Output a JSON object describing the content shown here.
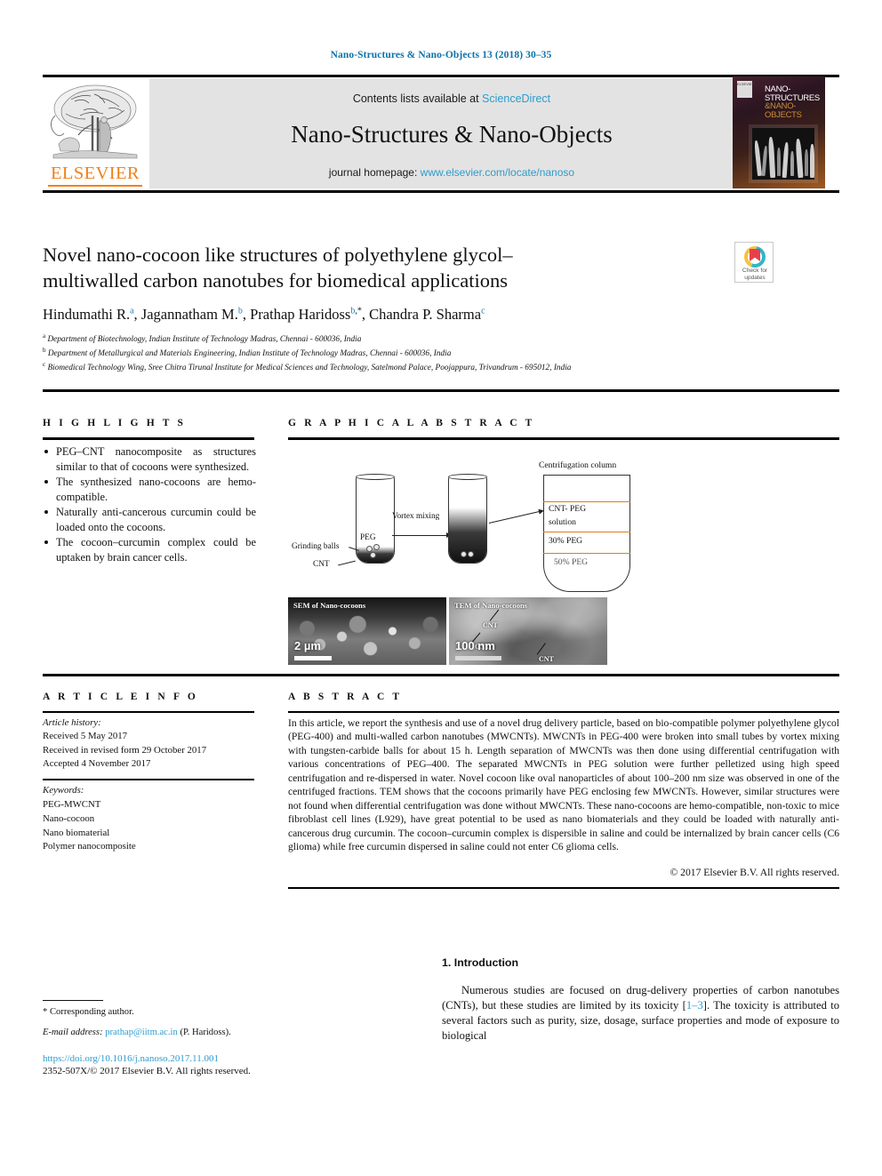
{
  "running_head": "Nano-Structures & Nano-Objects 13 (2018) 30–35",
  "masthead": {
    "contents_prefix": "Contents lists available at ",
    "contents_link": "ScienceDirect",
    "journal_name": "Nano-Structures & Nano-Objects",
    "homepage_prefix": "journal homepage: ",
    "homepage_link": "www.elsevier.com/locate/nanoso",
    "publisher_wordmark": "ELSEVIER"
  },
  "cover": {
    "line1": "NANO-",
    "line2": "STRUCTURES",
    "line3": "&NANO-",
    "line4": "OBJECTS",
    "badge": "ELSEVIER"
  },
  "crossmark": {
    "line1": "Check for",
    "line2": "updates"
  },
  "article": {
    "title": "Novel nano-cocoon like structures of polyethylene glycol–multiwalled carbon nanotubes for biomedical applications",
    "authors": [
      {
        "name": "Hindumathi R.",
        "sup": "a",
        "star": false
      },
      {
        "name": "Jagannatham M.",
        "sup": "b",
        "star": false
      },
      {
        "name": "Prathap Haridoss",
        "sup": "b",
        "star": true
      },
      {
        "name": "Chandra P. Sharma",
        "sup": "c",
        "star": false
      }
    ],
    "affiliations": [
      {
        "marker": "a",
        "text": "Department of Biotechnology, Indian Institute of Technology Madras, Chennai - 600036, India"
      },
      {
        "marker": "b",
        "text": "Department of Metallurgical and Materials Engineering, Indian Institute of Technology Madras, Chennai - 600036, India"
      },
      {
        "marker": "c",
        "text": "Biomedical Technology Wing, Sree Chitra Tirunal Institute for Medical Sciences and Technology, Satelmond Palace, Poojappura, Trivandrum - 695012, India"
      }
    ]
  },
  "highlights": {
    "heading": "H I G H L I G H T S",
    "items": [
      "PEG–CNT nanocomposite as structures similar to that of cocoons were synthesized.",
      "The synthesized nano-cocoons are hemo-compatible.",
      "Naturally anti-cancerous curcumin could be loaded onto the cocoons.",
      "The cocoon–curcumin complex could be uptaken by brain cancer cells."
    ]
  },
  "graphical_abstract": {
    "heading": "G R A P H I C A L   A B S T R A C T",
    "labels": {
      "grinding_balls": "Grinding balls",
      "cnt": "CNT",
      "peg": "PEG",
      "vortex_mixing": "Vortex mixing",
      "centrifugation_column": "Centrifugation column",
      "fraction_1_line1": "CNT- PEG",
      "fraction_1_line2": "solution",
      "fraction_2": "30% PEG",
      "fraction_3": "50% PEG"
    },
    "micrographs": [
      {
        "caption": "SEM of Nano-cocoons",
        "scale": "2 µm",
        "annotations": []
      },
      {
        "caption": "TEM of Nano-cocoons",
        "scale": "100 nm",
        "annotations": [
          "CNT",
          "CNT",
          "CNT"
        ]
      }
    ]
  },
  "article_info": {
    "heading": "A R T I C L E   I N F O",
    "history_label": "Article history:",
    "history": [
      "Received 5 May 2017",
      "Received in revised form 29 October 2017",
      "Accepted 4 November 2017"
    ],
    "keywords_label": "Keywords:",
    "keywords": [
      "PEG-MWCNT",
      "Nano-cocoon",
      "Nano biomaterial",
      "Polymer nanocomposite"
    ]
  },
  "abstract": {
    "heading": "A B S T R A C T",
    "text": "In this article, we report the synthesis and use of a novel drug delivery particle, based on bio-compatible polymer polyethylene glycol (PEG-400) and multi-walled carbon nanotubes (MWCNTs). MWCNTs in PEG-400 were broken into small tubes by vortex mixing with tungsten-carbide balls for about 15 h. Length separation of MWCNTs was then done using differential centrifugation with various concentrations of PEG–400. The separated MWCNTs in PEG solution were further pelletized using high speed centrifugation and re-dispersed in water. Novel cocoon like oval nanoparticles of about 100–200 nm size was observed in one of the centrifuged fractions. TEM shows that the cocoons primarily have PEG enclosing few MWCNTs. However, similar structures were not found when differential centrifugation was done without MWCNTs. These nano-cocoons are hemo-compatible, non-toxic to mice fibroblast cell lines (L929), have great potential to be used as nano biomaterials and they could be loaded with naturally anti-cancerous drug curcumin. The cocoon–curcumin complex is dispersible in saline and could be internalized by brain cancer cells (C6 glioma) while free curcumin dispersed in saline could not enter C6 glioma cells.",
    "copyright": "© 2017 Elsevier B.V. All rights reserved."
  },
  "introduction": {
    "number_and_title": "1.  Introduction",
    "paragraph_part1": "Numerous studies are focused on drug-delivery properties of carbon nanotubes (CNTs), but these studies are limited by its toxicity [",
    "reference": "1–3",
    "paragraph_part2": "]. The toxicity is attributed to several factors such as purity, size, dosage, surface properties and mode of exposure to biological"
  },
  "footnote": {
    "corresponding": "* Corresponding author.",
    "email_label": "E-mail address:",
    "email": "prathap@iitm.ac.in",
    "email_owner": "(P. Haridoss).",
    "doi": "https://doi.org/10.1016/j.nanoso.2017.11.001",
    "issn_copyright": "2352-507X/© 2017 Elsevier B.V. All rights reserved."
  },
  "colors": {
    "link": "#2e9ccc",
    "running_head": "#0b72a8",
    "elsevier_orange": "#f08019",
    "column_divider": "#e07b18"
  }
}
